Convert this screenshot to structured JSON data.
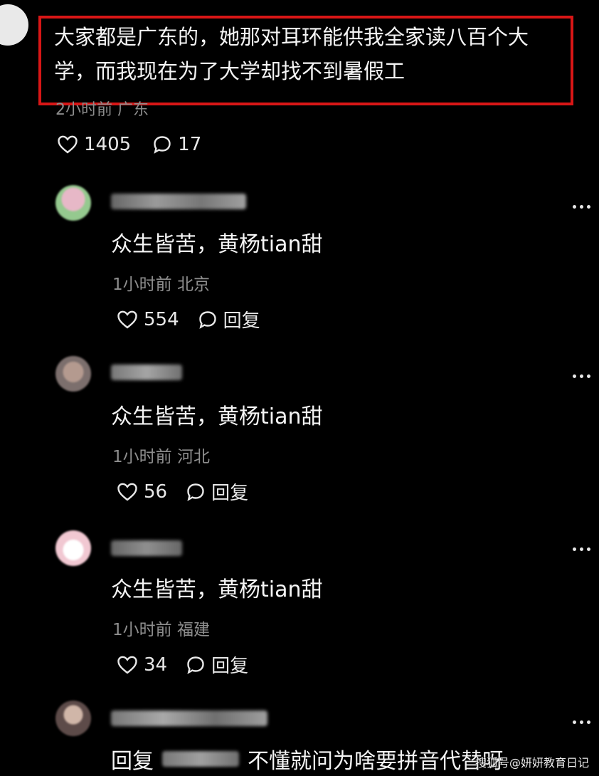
{
  "main_comment": {
    "text": "大家都是广东的，她那对耳环能供我全家读八百个大学，而我现在为了大学却找不到暑假工",
    "meta": "2小时前 广东",
    "likes": "1405",
    "comments": "17"
  },
  "replies": [
    {
      "text": "众生皆苦，黄杨tian甜",
      "meta": "1小时前 北京",
      "likes": "554",
      "reply_label": "回复"
    },
    {
      "text": "众生皆苦，黄杨tian甜",
      "meta": "1小时前 河北",
      "likes": "56",
      "reply_label": "回复"
    },
    {
      "text": "众生皆苦，黄杨tian甜",
      "meta": "1小时前 福建",
      "likes": "34",
      "reply_label": "回复"
    },
    {
      "text_prefix": "回复",
      "text_suffix": "不懂就问为啥要拼音代替呀"
    }
  ],
  "watermark": "搜狐号@妍妍教育日记",
  "icons": {
    "heart": "heart-icon",
    "comment": "comment-bubble-icon",
    "more": "more-dots-icon"
  },
  "colors": {
    "background": "#000000",
    "highlight_border": "#d81616",
    "primary_text": "#f5f5f5",
    "secondary_text": "#8e8e8e"
  }
}
